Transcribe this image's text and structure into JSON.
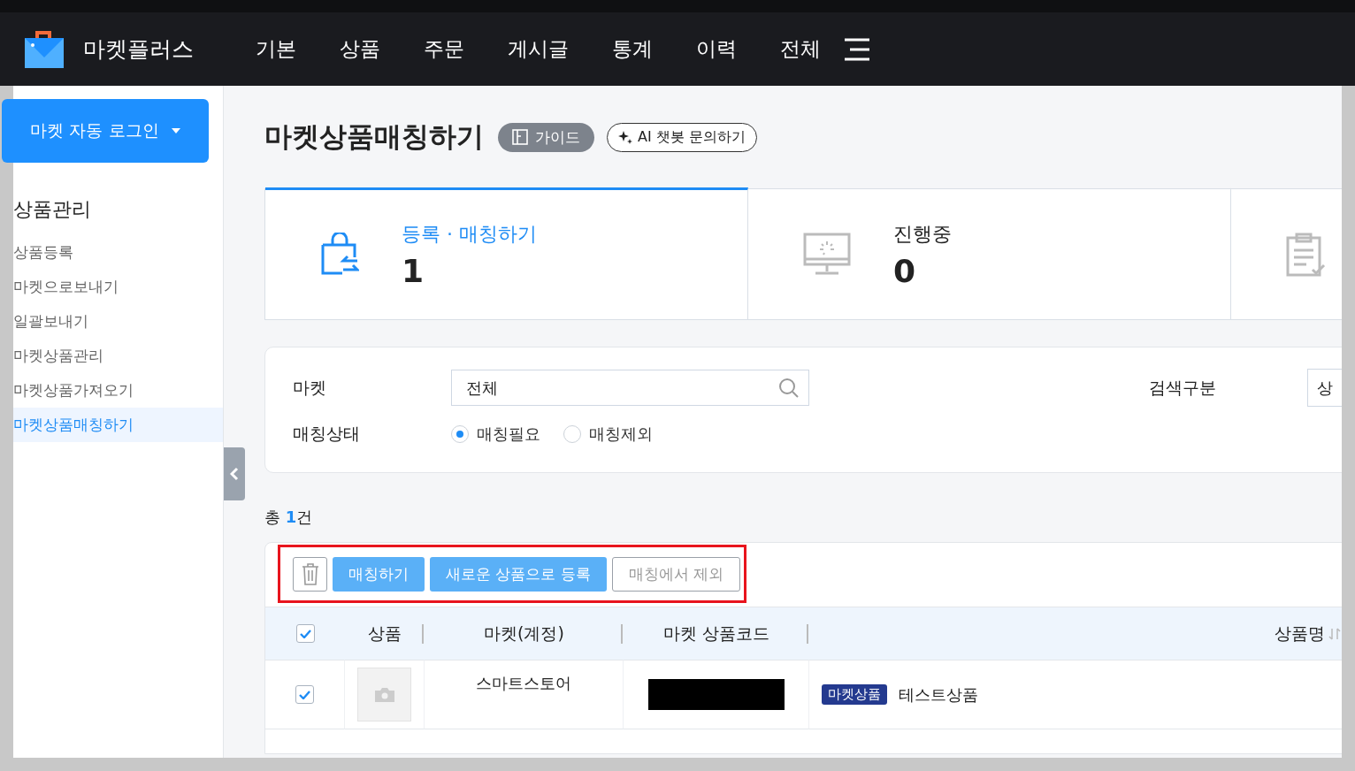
{
  "app": {
    "name": "마켓플러스"
  },
  "nav": [
    {
      "label": "기본"
    },
    {
      "label": "상품"
    },
    {
      "label": "주문"
    },
    {
      "label": "게시글"
    },
    {
      "label": "통계"
    },
    {
      "label": "이력"
    },
    {
      "label": "전체"
    }
  ],
  "sidebar": {
    "login_button": "마켓 자동 로그인",
    "section": "상품관리",
    "items": [
      {
        "label": "상품등록",
        "selected": false
      },
      {
        "label": "마켓으로보내기",
        "selected": false
      },
      {
        "label": "일괄보내기",
        "selected": false
      },
      {
        "label": "마켓상품관리",
        "selected": false
      },
      {
        "label": "마켓상품가져오기",
        "selected": false
      },
      {
        "label": "마켓상품매칭하기",
        "selected": true
      }
    ]
  },
  "page": {
    "title": "마켓상품매칭하기",
    "guide": "가이드",
    "ai_button": "AI 챗봇 문의하기"
  },
  "status_cards": [
    {
      "kind": "register",
      "label": "등록 · 매칭하기",
      "count": "1",
      "selected": true
    },
    {
      "kind": "progress",
      "label": "진행중",
      "count": "0",
      "selected": false
    },
    {
      "kind": "done",
      "selected": false
    }
  ],
  "filters": {
    "market": {
      "label": "마켓",
      "value": "전체"
    },
    "search_type": {
      "label": "검색구분",
      "value": "상"
    },
    "match_status": {
      "label": "매칭상태",
      "options": [
        {
          "label": "매칭필요",
          "selected": true
        },
        {
          "label": "매칭제외",
          "selected": false
        }
      ]
    }
  },
  "total": "총 **1**건",
  "toolbar": {
    "buttons": [
      {
        "kind": "primary",
        "label": "매칭하기"
      },
      {
        "kind": "primary",
        "label": "새로운 상품으로 등록"
      },
      {
        "kind": "outline",
        "label": "매칭에서 제외"
      }
    ]
  },
  "table": {
    "header_checked": true,
    "columns": [
      "상품",
      "마켓(계정)",
      "마켓 상품코드",
      "상품명"
    ],
    "rows": [
      {
        "checked": true,
        "market": "스마트스토어",
        "badge": "마켓상품",
        "name": "테스트상품"
      }
    ]
  }
}
